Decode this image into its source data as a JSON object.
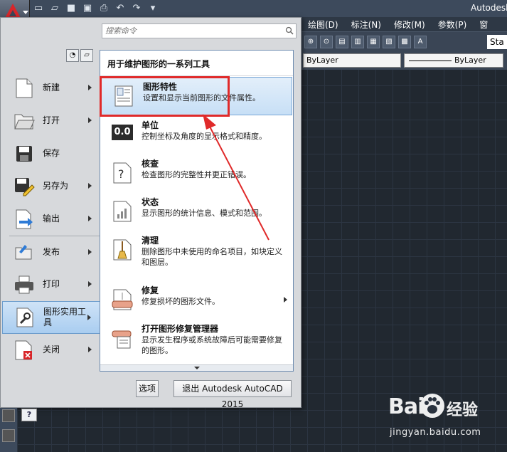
{
  "window": {
    "title": "Autodesk"
  },
  "menubar": {
    "items": [
      "绘图(D)",
      "标注(N)",
      "修改(M)",
      "参数(P)",
      "窗"
    ]
  },
  "toolbar": {
    "style_value": "Sta"
  },
  "properties": {
    "layer_value": "ByLayer",
    "linetype_value": "ByLayer"
  },
  "search": {
    "placeholder": "搜索命令"
  },
  "nav": {
    "items": [
      {
        "label": "新建",
        "has_arrow": true
      },
      {
        "label": "打开",
        "has_arrow": true
      },
      {
        "label": "保存",
        "has_arrow": false
      },
      {
        "label": "另存为",
        "has_arrow": true
      },
      {
        "label": "输出",
        "has_arrow": true
      },
      {
        "label": "发布",
        "has_arrow": true
      },
      {
        "label": "打印",
        "has_arrow": true
      },
      {
        "label": "图形实用工具",
        "has_arrow": true
      },
      {
        "label": "关闭",
        "has_arrow": true
      }
    ]
  },
  "panel": {
    "header": "用于维护图形的一系列工具",
    "items": [
      {
        "title": "图形特性",
        "desc": "设置和显示当前图形的文件属性。"
      },
      {
        "title": "单位",
        "desc": "控制坐标及角度的显示格式和精度。"
      },
      {
        "title": "核查",
        "desc": "检查图形的完整性并更正错误。"
      },
      {
        "title": "状态",
        "desc": "显示图形的统计信息、模式和范围。"
      },
      {
        "title": "清理",
        "desc": "删除图形中未使用的命名项目，如块定义和图层。"
      },
      {
        "title": "修复",
        "desc": "修复损坏的图形文件。"
      },
      {
        "title": "打开图形修复管理器",
        "desc": "显示发生程序或系统故障后可能需要修复的图形。"
      }
    ]
  },
  "footer": {
    "options_label": "选项",
    "exit_label": "退出 Autodesk AutoCAD 2015"
  },
  "units_icon_text": "0.0",
  "watermark": {
    "logo": "Bai",
    "logo_suffix": "du",
    "cn": "经验",
    "url": "jingyan.baidu.com"
  },
  "colors": {
    "accent_red": "#e02a2a",
    "highlight": "#c7dff6",
    "autocad_red": "#d8262a"
  }
}
